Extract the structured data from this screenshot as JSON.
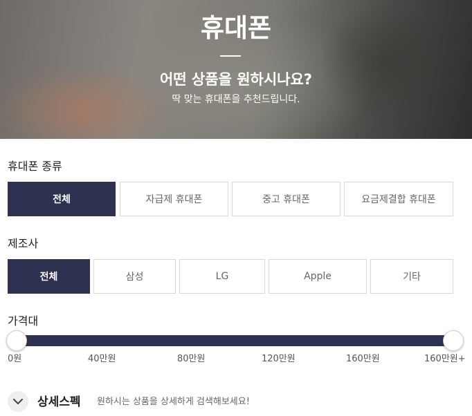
{
  "hero": {
    "title": "휴대폰",
    "subtitle": "어떤 상품을 원하시나요?",
    "description": "딱 맞는 휴대폰을 추천드립니다."
  },
  "phone_type": {
    "label": "휴대폰 종류",
    "options": [
      "전체",
      "자급제 휴대폰",
      "중고 휴대폰",
      "요금제결합 휴대폰"
    ],
    "selected": "전체"
  },
  "manufacturer": {
    "label": "제조사",
    "options": [
      "전체",
      "삼성",
      "LG",
      "Apple",
      "기타"
    ],
    "selected": "전체"
  },
  "price": {
    "label": "가격대",
    "ticks": [
      "0원",
      "40만원",
      "80만원",
      "120만원",
      "160만원",
      "160만원+"
    ],
    "range_min_fraction": 0,
    "range_max_fraction": 1
  },
  "detail_spec": {
    "title": "상세스펙",
    "description": "원하시는 상품을 상세하게 검색해보세요!",
    "toggle_icon": "chevron-down-icon"
  },
  "colors": {
    "accent": "#2e3150"
  }
}
